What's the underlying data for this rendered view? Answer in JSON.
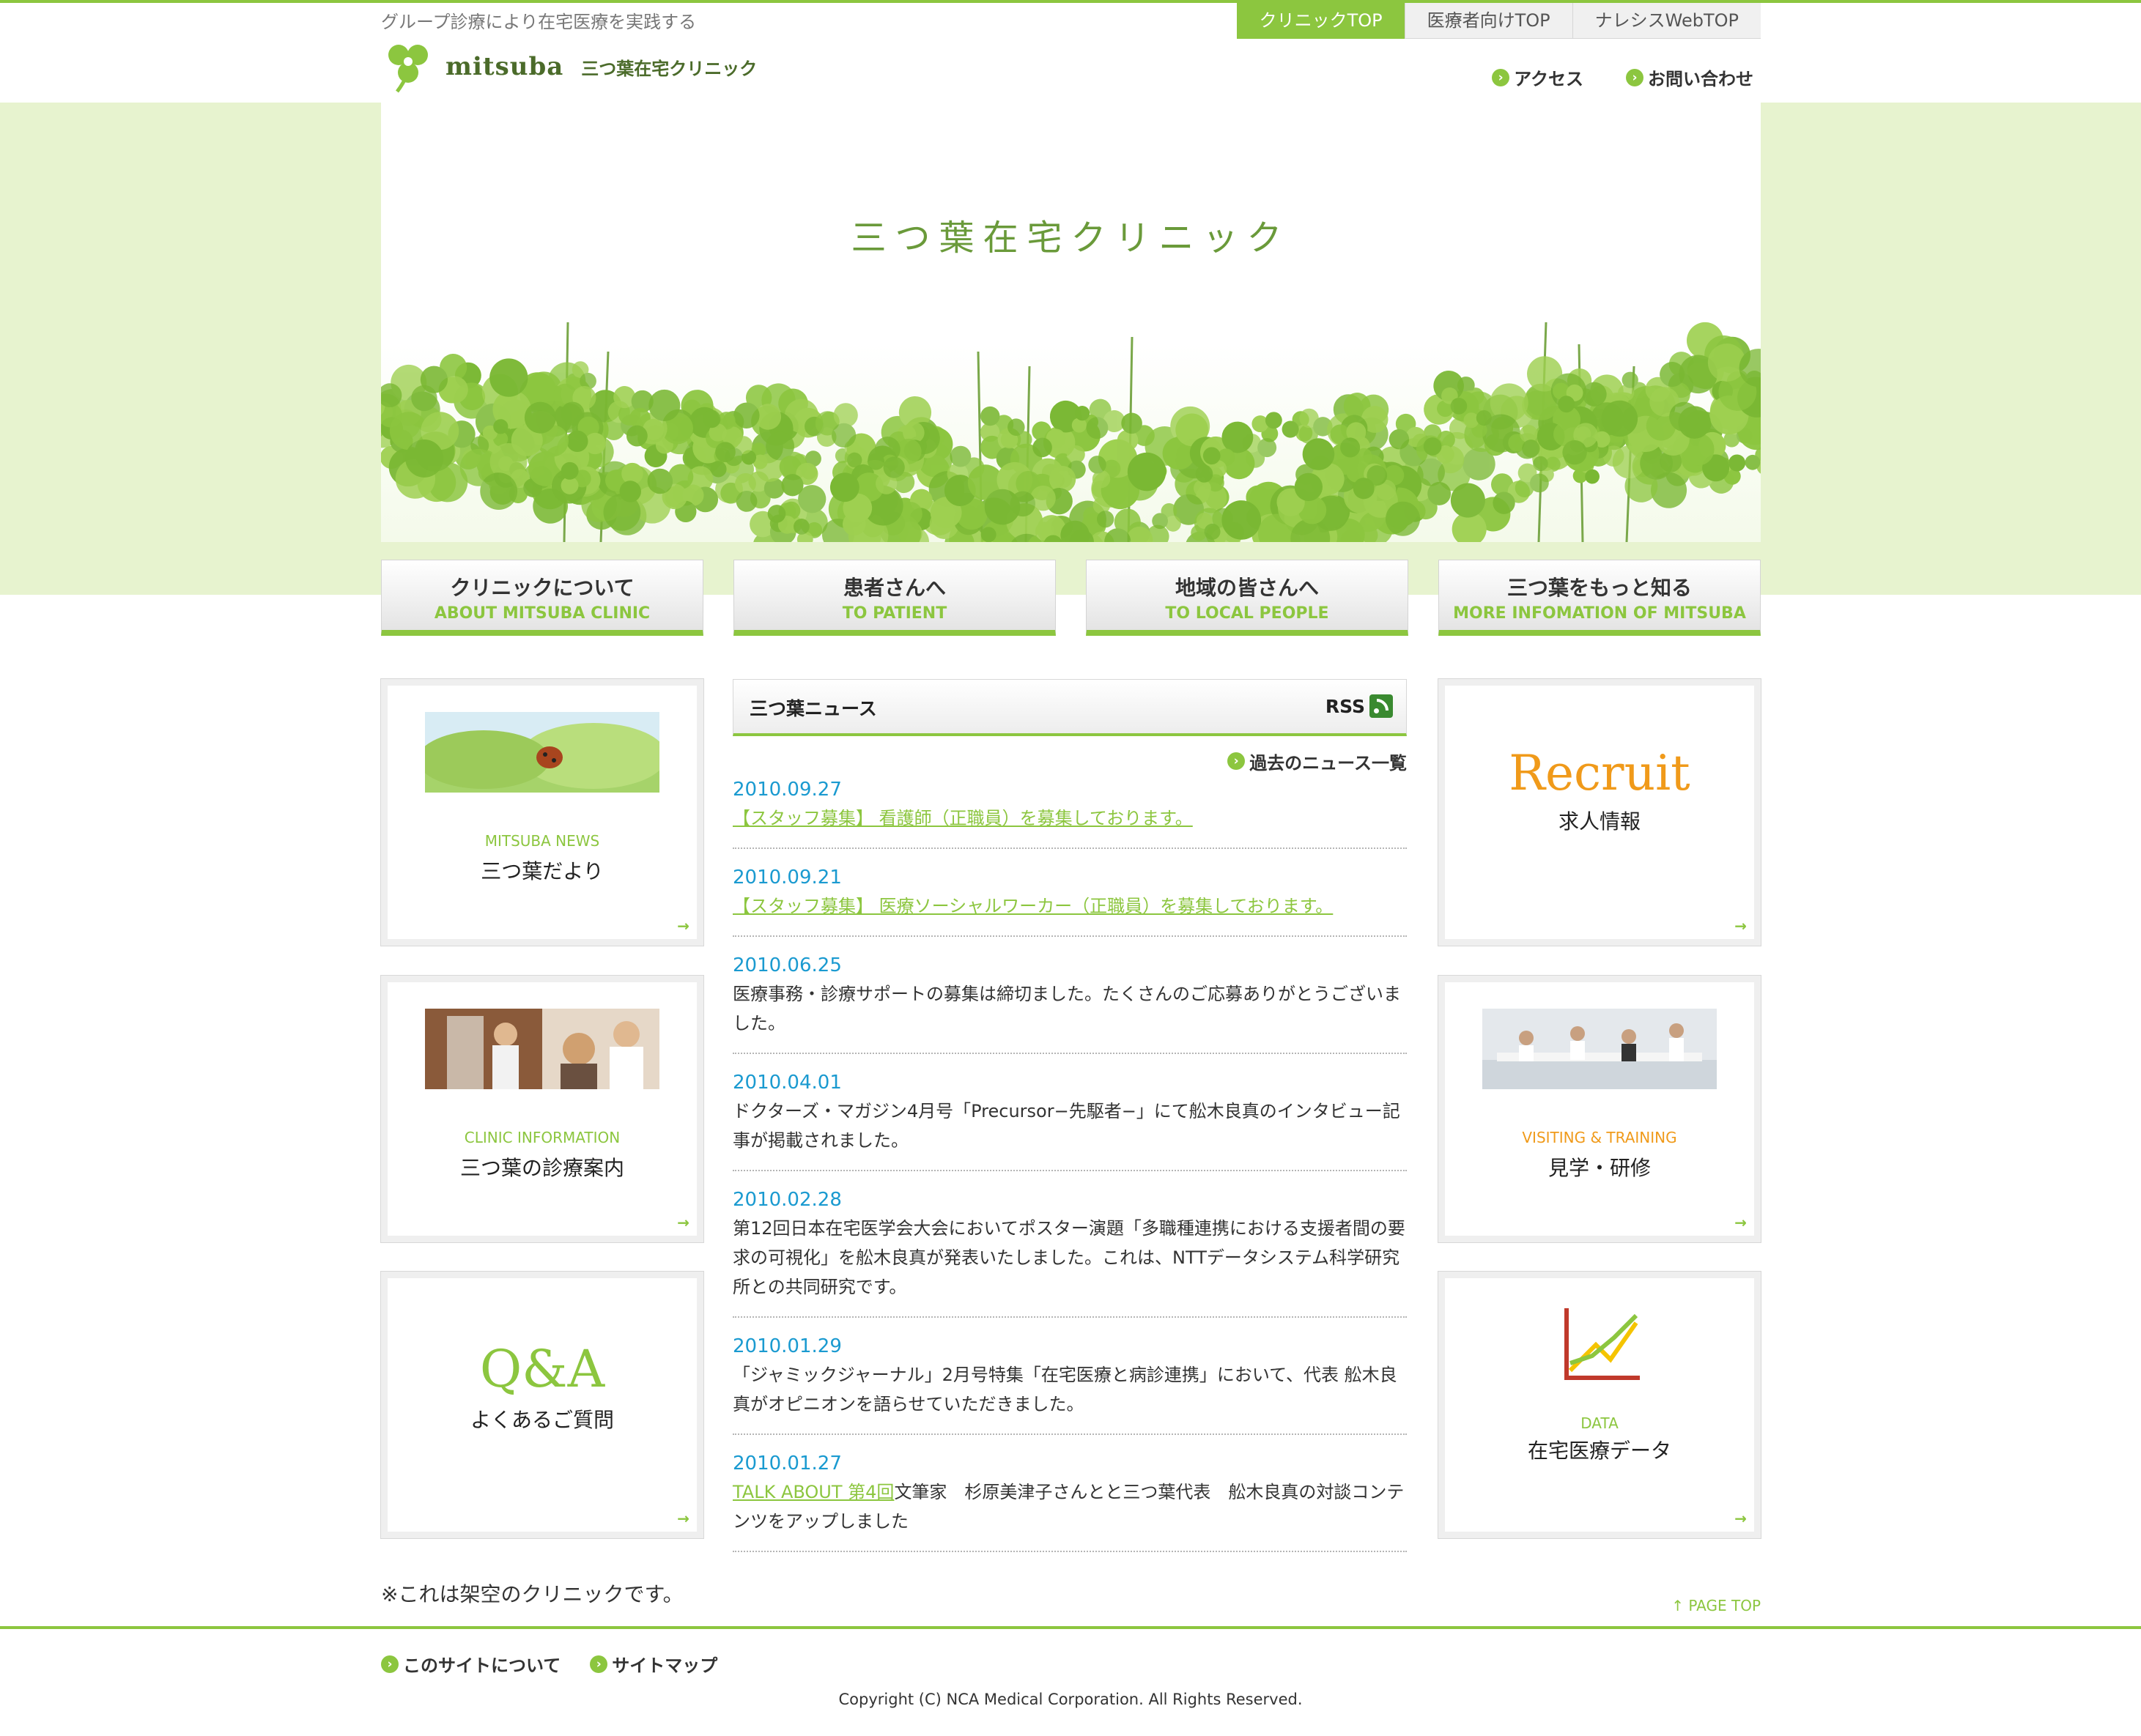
{
  "header": {
    "tagline": "グループ診療により在宅医療を実践する",
    "tabs": [
      "クリニックTOP",
      "医療者向けTOP",
      "ナレシスWebTOP"
    ],
    "logo_name": "mitsuba",
    "logo_jp": "三つ葉在宅クリニック",
    "access": "アクセス",
    "contact": "お問い合わせ"
  },
  "hero": {
    "title": "三つ葉在宅クリニック"
  },
  "nav": [
    {
      "jp": "クリニックについて",
      "en": "ABOUT MITSUBA CLINIC"
    },
    {
      "jp": "患者さんへ",
      "en": "TO PATIENT"
    },
    {
      "jp": "地域の皆さんへ",
      "en": "TO LOCAL PEOPLE"
    },
    {
      "jp": "三つ葉をもっと知る",
      "en": "MORE INFOMATION OF MITSUBA"
    }
  ],
  "left_cards": [
    {
      "en": "MITSUBA NEWS",
      "jp": "三つ葉だより"
    },
    {
      "en": "CLINIC INFORMATION",
      "jp": "三つ葉の診療案内"
    },
    {
      "logo": "Q&A",
      "jp": "よくあるご質問"
    }
  ],
  "right_cards": [
    {
      "logo": "Recruit",
      "jp": "求人情報"
    },
    {
      "en": "VISITING & TRAINING",
      "jp": "見学・研修"
    },
    {
      "en": "DATA",
      "jp": "在宅医療データ"
    }
  ],
  "news": {
    "title": "三つ葉ニュース",
    "rss": "RSS",
    "past": "過去のニュース一覧",
    "items": [
      {
        "date": "2010.09.27",
        "text": "【スタッフ募集】 看護師（正職員）を募集しております。"
      },
      {
        "date": "2010.09.21",
        "text": "【スタッフ募集】 医療ソーシャルワーカー（正職員）を募集しております。"
      },
      {
        "date": "2010.06.25",
        "text": "医療事務・診療サポートの募集は締切ました。たくさんのご応募ありがとうございました。"
      },
      {
        "date": "2010.04.01",
        "text": "ドクターズ・マガジン4月号「Precursor−先駆者−」にて舩木良真のインタビュー記事が掲載されました。"
      },
      {
        "date": "2010.02.28",
        "text": "第12回日本在宅医学会大会においてポスター演題「多職種連携における支援者間の要求の可視化」を舩木良真が発表いたしました。これは、NTTデータシステム科学研究所との共同研究です。"
      },
      {
        "date": "2010.01.29",
        "text": "「ジャミックジャーナル」2月号特集「在宅医療と病診連携」において、代表 舩木良真がオピニオンを語らせていただきました。"
      },
      {
        "date": "2010.01.27",
        "link": "TALK ABOUT 第4回",
        "text": "文筆家　杉原美津子さんとと三つ葉代表　舩木良真の対談コンテンツをアップしました"
      }
    ]
  },
  "footer": {
    "note": "※これは架空のクリニックです。",
    "pagetop": "PAGE TOP",
    "about": "このサイトについて",
    "sitemap": "サイトマップ",
    "copyright": "Copyright (C) NCA Medical Corporation. All Rights Reserved."
  }
}
